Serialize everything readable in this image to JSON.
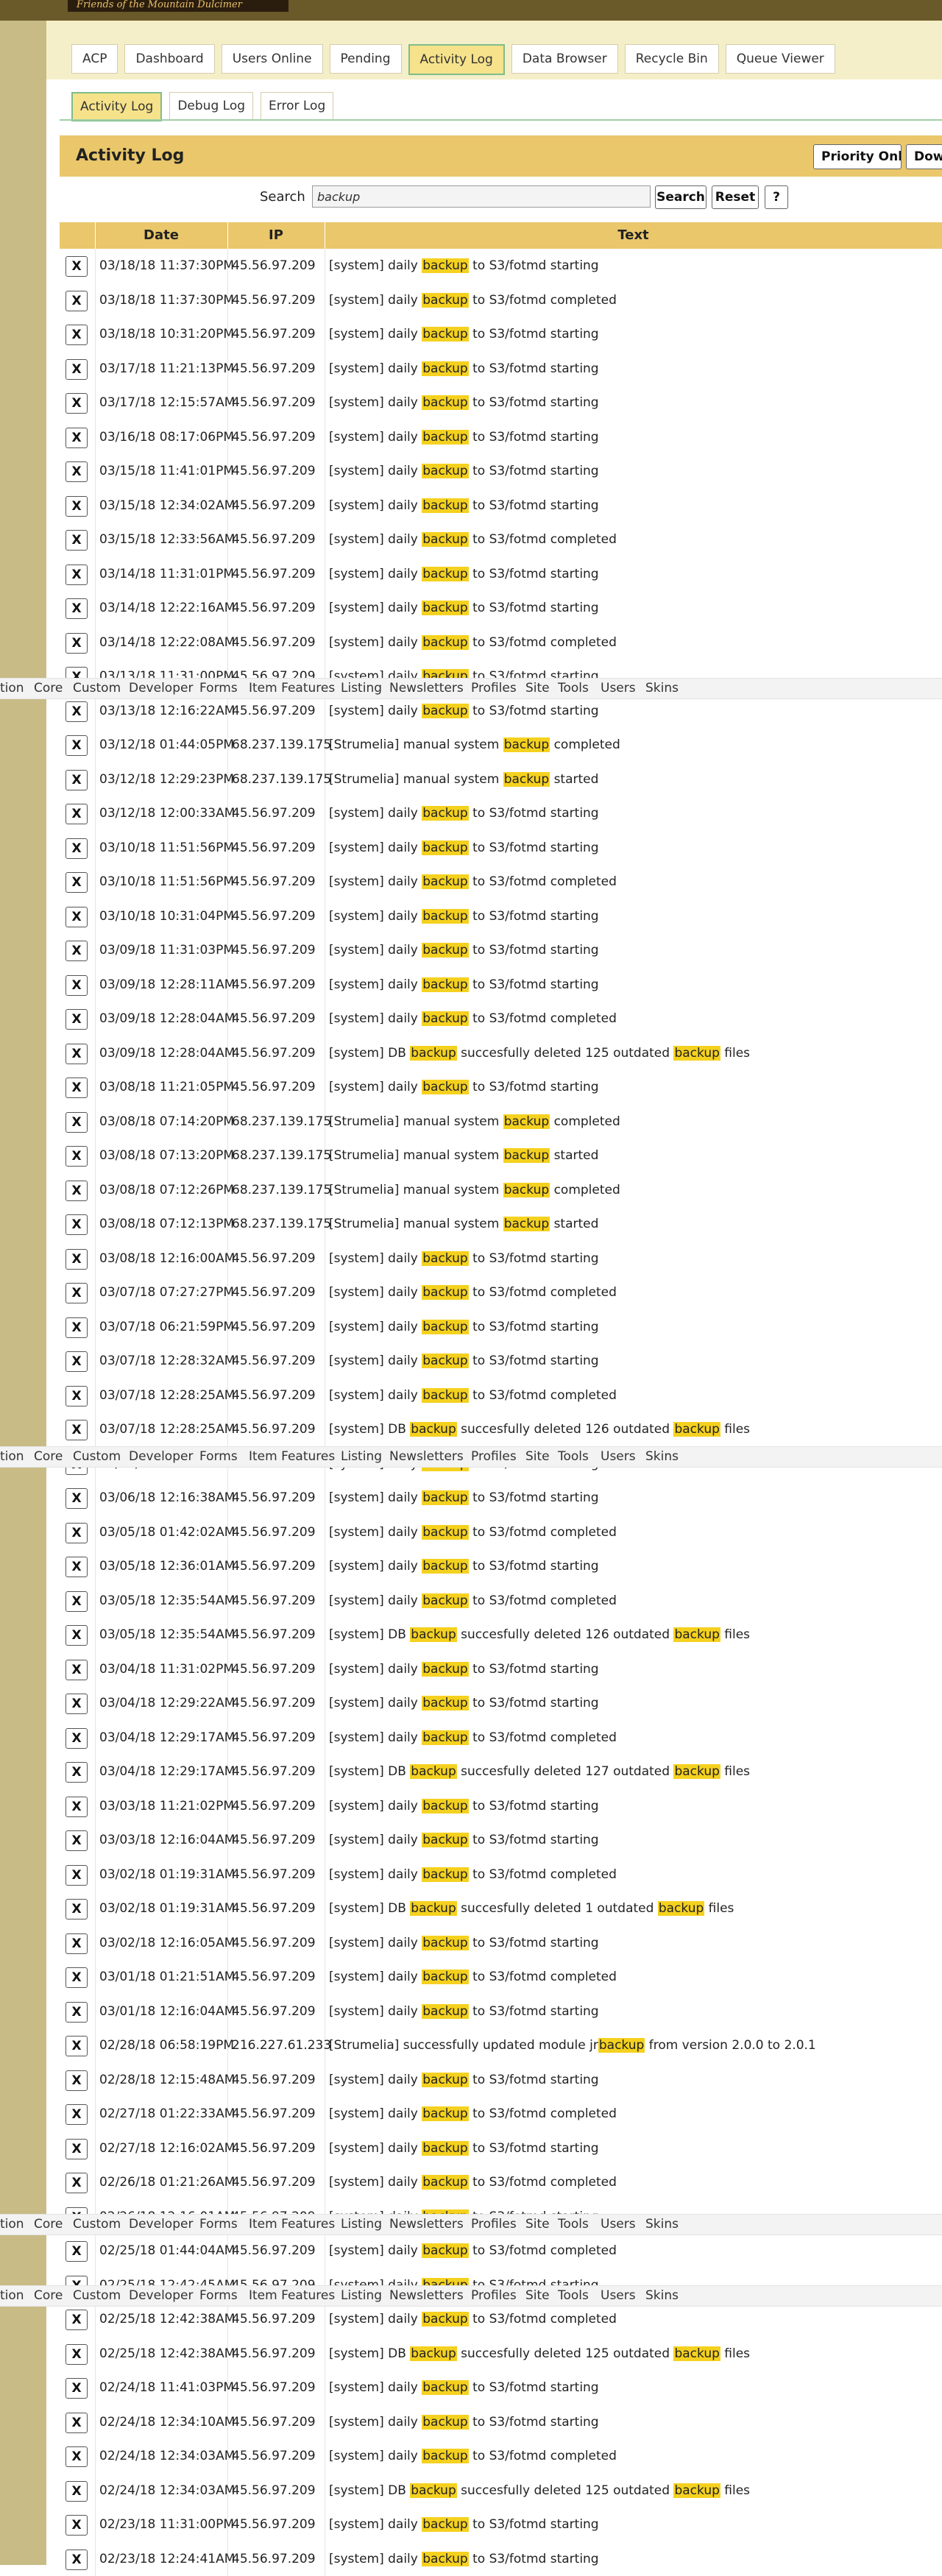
{
  "brand": {
    "logo_text": "Friends of the Mountain Dulcimer"
  },
  "nav": {
    "tabs": [
      "ACP",
      "Dashboard",
      "Users Online",
      "Pending",
      "Activity Log",
      "Data Browser",
      "Recycle Bin",
      "Queue Viewer"
    ],
    "active": "Activity Log"
  },
  "subnav": {
    "tabs": [
      "Activity Log",
      "Debug Log",
      "Error Log"
    ],
    "active": "Activity Log"
  },
  "page": {
    "title": "Activity Log",
    "priority_button": "Priority Only",
    "download_button": "Down"
  },
  "search": {
    "label": "Search",
    "value": "backup",
    "search_button": "Search",
    "reset_button": "Reset",
    "help_button": "?"
  },
  "table": {
    "columns": [
      "Date",
      "IP",
      "Text"
    ],
    "delete_label": "X",
    "highlight": "backup",
    "rows": [
      {
        "date": "03/18/18 11:37:30PM",
        "ip": "45.56.97.209",
        "text": "[system] daily backup to S3/fotmd starting"
      },
      {
        "date": "03/18/18 11:37:30PM",
        "ip": "45.56.97.209",
        "text": "[system] daily backup to S3/fotmd completed"
      },
      {
        "date": "03/18/18 10:31:20PM",
        "ip": "45.56.97.209",
        "text": "[system] daily backup to S3/fotmd starting"
      },
      {
        "date": "03/17/18 11:21:13PM",
        "ip": "45.56.97.209",
        "text": "[system] daily backup to S3/fotmd starting"
      },
      {
        "date": "03/17/18 12:15:57AM",
        "ip": "45.56.97.209",
        "text": "[system] daily backup to S3/fotmd starting"
      },
      {
        "date": "03/16/18 08:17:06PM",
        "ip": "45.56.97.209",
        "text": "[system] daily backup to S3/fotmd starting"
      },
      {
        "date": "03/15/18 11:41:01PM",
        "ip": "45.56.97.209",
        "text": "[system] daily backup to S3/fotmd starting"
      },
      {
        "date": "03/15/18 12:34:02AM",
        "ip": "45.56.97.209",
        "text": "[system] daily backup to S3/fotmd starting"
      },
      {
        "date": "03/15/18 12:33:56AM",
        "ip": "45.56.97.209",
        "text": "[system] daily backup to S3/fotmd completed"
      },
      {
        "date": "03/14/18 11:31:01PM",
        "ip": "45.56.97.209",
        "text": "[system] daily backup to S3/fotmd starting"
      },
      {
        "date": "03/14/18 12:22:16AM",
        "ip": "45.56.97.209",
        "text": "[system] daily backup to S3/fotmd starting"
      },
      {
        "date": "03/14/18 12:22:08AM",
        "ip": "45.56.97.209",
        "text": "[system] daily backup to S3/fotmd completed"
      },
      {
        "date": "03/13/18 11:31:00PM",
        "ip": "45.56.97.209",
        "text": "[system] daily backup to S3/fotmd starting"
      },
      {
        "date": "03/13/18 12:16:22AM",
        "ip": "45.56.97.209",
        "text": "[system] daily backup to S3/fotmd starting"
      },
      {
        "date": "03/12/18 01:44:05PM",
        "ip": "68.237.139.175",
        "text": "[Strumelia] manual system backup completed"
      },
      {
        "date": "03/12/18 12:29:23PM",
        "ip": "68.237.139.175",
        "text": "[Strumelia] manual system backup started"
      },
      {
        "date": "03/12/18 12:00:33AM",
        "ip": "45.56.97.209",
        "text": "[system] daily backup to S3/fotmd starting"
      },
      {
        "date": "03/10/18 11:51:56PM",
        "ip": "45.56.97.209",
        "text": "[system] daily backup to S3/fotmd starting"
      },
      {
        "date": "03/10/18 11:51:56PM",
        "ip": "45.56.97.209",
        "text": "[system] daily backup to S3/fotmd completed"
      },
      {
        "date": "03/10/18 10:31:04PM",
        "ip": "45.56.97.209",
        "text": "[system] daily backup to S3/fotmd starting"
      },
      {
        "date": "03/09/18 11:31:03PM",
        "ip": "45.56.97.209",
        "text": "[system] daily backup to S3/fotmd starting"
      },
      {
        "date": "03/09/18 12:28:11AM",
        "ip": "45.56.97.209",
        "text": "[system] daily backup to S3/fotmd starting"
      },
      {
        "date": "03/09/18 12:28:04AM",
        "ip": "45.56.97.209",
        "text": "[system] daily backup to S3/fotmd completed"
      },
      {
        "date": "03/09/18 12:28:04AM",
        "ip": "45.56.97.209",
        "text": "[system] DB backup succesfully deleted 125 outdated backup files"
      },
      {
        "date": "03/08/18 11:21:05PM",
        "ip": "45.56.97.209",
        "text": "[system] daily backup to S3/fotmd starting"
      },
      {
        "date": "03/08/18 07:14:20PM",
        "ip": "68.237.139.175",
        "text": "[Strumelia] manual system backup completed"
      },
      {
        "date": "03/08/18 07:13:20PM",
        "ip": "68.237.139.175",
        "text": "[Strumelia] manual system backup started"
      },
      {
        "date": "03/08/18 07:12:26PM",
        "ip": "68.237.139.175",
        "text": "[Strumelia] manual system backup completed"
      },
      {
        "date": "03/08/18 07:12:13PM",
        "ip": "68.237.139.175",
        "text": "[Strumelia] manual system backup started"
      },
      {
        "date": "03/08/18 12:16:00AM",
        "ip": "45.56.97.209",
        "text": "[system] daily backup to S3/fotmd starting"
      },
      {
        "date": "03/07/18 07:27:27PM",
        "ip": "45.56.97.209",
        "text": "[system] daily backup to S3/fotmd completed"
      },
      {
        "date": "03/07/18 06:21:59PM",
        "ip": "45.56.97.209",
        "text": "[system] daily backup to S3/fotmd starting"
      },
      {
        "date": "03/07/18 12:28:32AM",
        "ip": "45.56.97.209",
        "text": "[system] daily backup to S3/fotmd starting"
      },
      {
        "date": "03/07/18 12:28:25AM",
        "ip": "45.56.97.209",
        "text": "[system] daily backup to S3/fotmd completed"
      },
      {
        "date": "03/07/18 12:28:25AM",
        "ip": "45.56.97.209",
        "text": "[system] DB backup succesfully deleted 126 outdated backup files"
      },
      {
        "date": "03/06/18 11:21:03PM",
        "ip": "45.56.97.209",
        "text": "[system] daily backup to S3/fotmd starting"
      },
      {
        "date": "03/06/18 12:16:38AM",
        "ip": "45.56.97.209",
        "text": "[system] daily backup to S3/fotmd starting"
      },
      {
        "date": "03/05/18 01:42:02AM",
        "ip": "45.56.97.209",
        "text": "[system] daily backup to S3/fotmd completed"
      },
      {
        "date": "03/05/18 12:36:01AM",
        "ip": "45.56.97.209",
        "text": "[system] daily backup to S3/fotmd starting"
      },
      {
        "date": "03/05/18 12:35:54AM",
        "ip": "45.56.97.209",
        "text": "[system] daily backup to S3/fotmd completed"
      },
      {
        "date": "03/05/18 12:35:54AM",
        "ip": "45.56.97.209",
        "text": "[system] DB backup succesfully deleted 126 outdated backup files"
      },
      {
        "date": "03/04/18 11:31:02PM",
        "ip": "45.56.97.209",
        "text": "[system] daily backup to S3/fotmd starting"
      },
      {
        "date": "03/04/18 12:29:22AM",
        "ip": "45.56.97.209",
        "text": "[system] daily backup to S3/fotmd starting"
      },
      {
        "date": "03/04/18 12:29:17AM",
        "ip": "45.56.97.209",
        "text": "[system] daily backup to S3/fotmd completed"
      },
      {
        "date": "03/04/18 12:29:17AM",
        "ip": "45.56.97.209",
        "text": "[system] DB backup succesfully deleted 127 outdated backup files"
      },
      {
        "date": "03/03/18 11:21:02PM",
        "ip": "45.56.97.209",
        "text": "[system] daily backup to S3/fotmd starting"
      },
      {
        "date": "03/03/18 12:16:04AM",
        "ip": "45.56.97.209",
        "text": "[system] daily backup to S3/fotmd starting"
      },
      {
        "date": "03/02/18 01:19:31AM",
        "ip": "45.56.97.209",
        "text": "[system] daily backup to S3/fotmd completed"
      },
      {
        "date": "03/02/18 01:19:31AM",
        "ip": "45.56.97.209",
        "text": "[system] DB backup succesfully deleted 1 outdated backup files"
      },
      {
        "date": "03/02/18 12:16:05AM",
        "ip": "45.56.97.209",
        "text": "[system] daily backup to S3/fotmd starting"
      },
      {
        "date": "03/01/18 01:21:51AM",
        "ip": "45.56.97.209",
        "text": "[system] daily backup to S3/fotmd completed"
      },
      {
        "date": "03/01/18 12:16:04AM",
        "ip": "45.56.97.209",
        "text": "[system] daily backup to S3/fotmd starting"
      },
      {
        "date": "02/28/18 06:58:19PM",
        "ip": "216.227.61.233",
        "text": "[Strumelia] successfully updated module jrbackup from version 2.0.0 to 2.0.1"
      },
      {
        "date": "02/28/18 12:15:48AM",
        "ip": "45.56.97.209",
        "text": "[system] daily backup to S3/fotmd starting"
      },
      {
        "date": "02/27/18 01:22:33AM",
        "ip": "45.56.97.209",
        "text": "[system] daily backup to S3/fotmd completed"
      },
      {
        "date": "02/27/18 12:16:02AM",
        "ip": "45.56.97.209",
        "text": "[system] daily backup to S3/fotmd starting"
      },
      {
        "date": "02/26/18 01:21:26AM",
        "ip": "45.56.97.209",
        "text": "[system] daily backup to S3/fotmd completed"
      },
      {
        "date": "02/26/18 12:16:01AM",
        "ip": "45.56.97.209",
        "text": "[system] daily backup to S3/fotmd starting"
      },
      {
        "date": "02/25/18 01:44:04AM",
        "ip": "45.56.97.209",
        "text": "[system] daily backup to S3/fotmd completed"
      },
      {
        "date": "02/25/18 12:42:45AM",
        "ip": "45.56.97.209",
        "text": "[system] daily backup to S3/fotmd starting"
      },
      {
        "date": "02/25/18 12:42:38AM",
        "ip": "45.56.97.209",
        "text": "[system] daily backup to S3/fotmd completed"
      },
      {
        "date": "02/25/18 12:42:38AM",
        "ip": "45.56.97.209",
        "text": "[system] DB backup succesfully deleted 125 outdated backup files"
      },
      {
        "date": "02/24/18 11:41:03PM",
        "ip": "45.56.97.209",
        "text": "[system] daily backup to S3/fotmd starting"
      },
      {
        "date": "02/24/18 12:34:10AM",
        "ip": "45.56.97.209",
        "text": "[system] daily backup to S3/fotmd starting"
      },
      {
        "date": "02/24/18 12:34:03AM",
        "ip": "45.56.97.209",
        "text": "[system] daily backup to S3/fotmd completed"
      },
      {
        "date": "02/24/18 12:34:03AM",
        "ip": "45.56.97.209",
        "text": "[system] DB backup succesfully deleted 125 outdated backup files"
      },
      {
        "date": "02/23/18 11:31:00PM",
        "ip": "45.56.97.209",
        "text": "[system] daily backup to S3/fotmd starting"
      },
      {
        "date": "02/23/18 12:24:41AM",
        "ip": "45.56.97.209",
        "text": "[system] daily backup to S3/fotmd starting"
      }
    ]
  },
  "category_bar": {
    "items": [
      "tion",
      "Core",
      "Custom",
      "Developer",
      "Forms",
      "Item Features",
      "Listing",
      "Newsletters",
      "Profiles",
      "Site",
      "Tools",
      "Users",
      "Skins"
    ]
  },
  "colors": {
    "highlight": "#f5d11f",
    "header_bg": "#eac76b",
    "sidebar": "#c8bb86",
    "active_tab": "#f6e28a",
    "active_tab_border": "#7ebd8a"
  }
}
